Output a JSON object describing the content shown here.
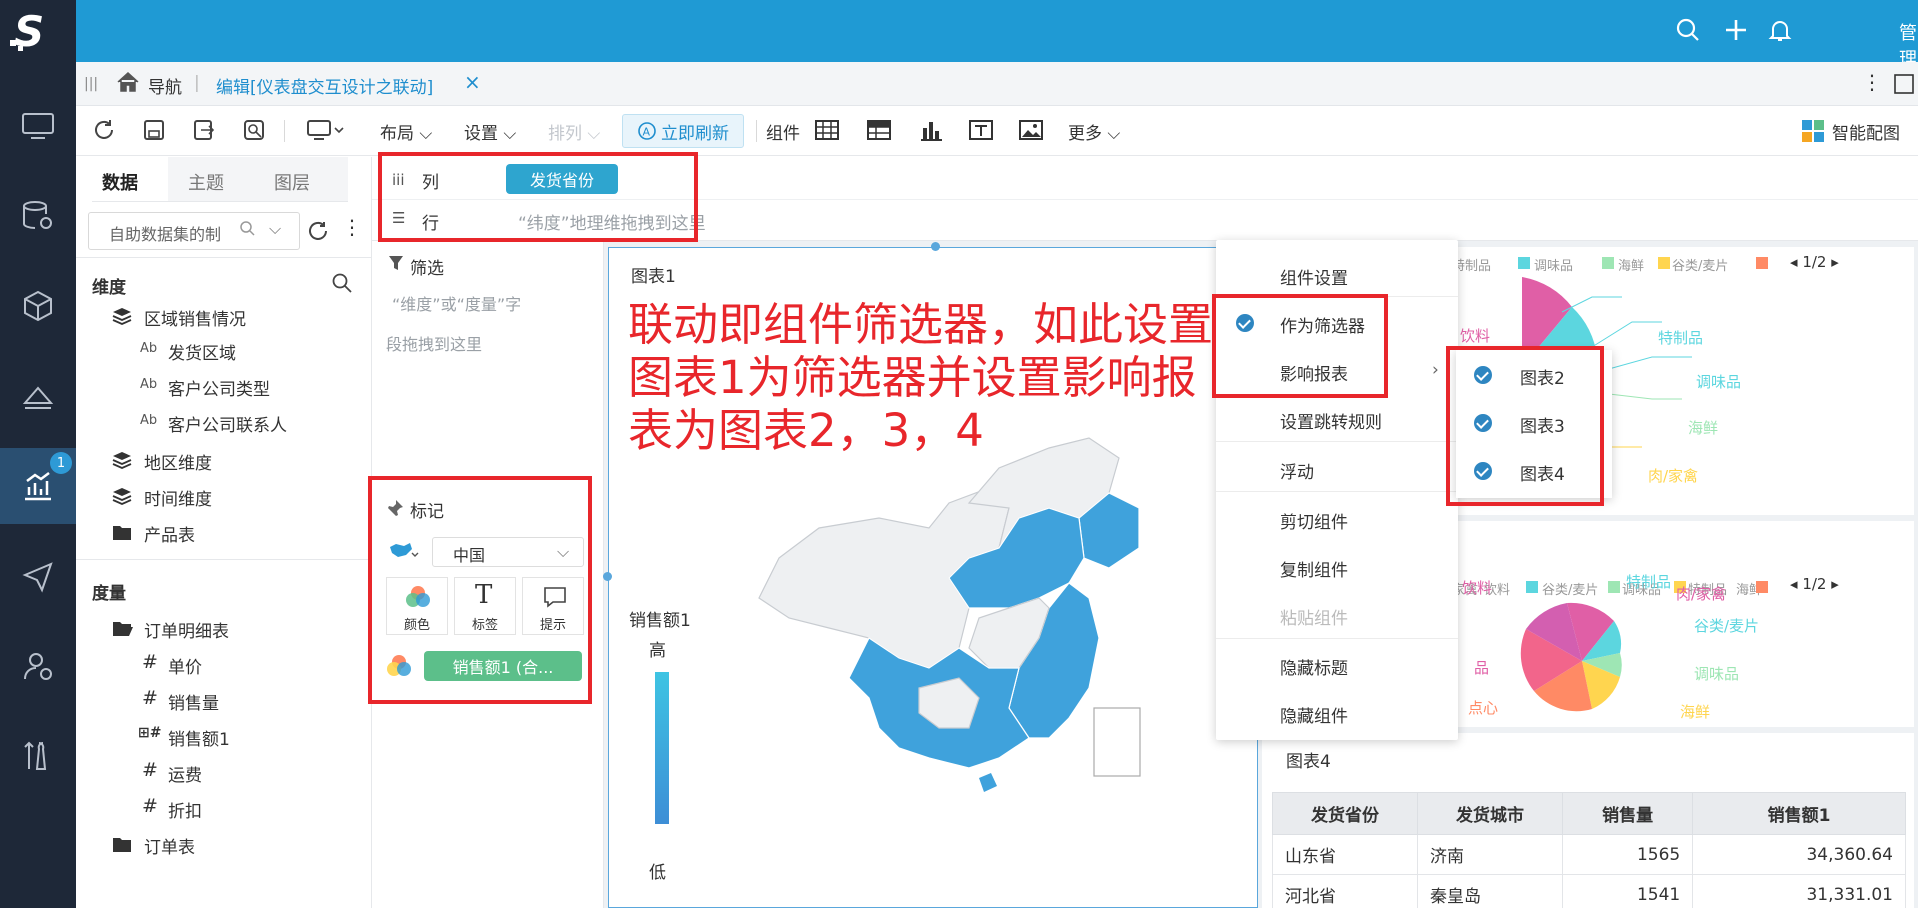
{
  "topbar": {
    "user_label": "管理员"
  },
  "sidebar": {
    "badge": "1"
  },
  "tabbar": {
    "nav_label": "导航",
    "tab_label": "编辑[仪表盘交互设计之联动]",
    "close": "×"
  },
  "toolbar": {
    "layout": "布局",
    "settings": "设置",
    "arrange": "排列",
    "refresh": "立即刷新",
    "component": "组件",
    "more": "更多",
    "smart": "智能配图"
  },
  "left_tabs": [
    "数据",
    "主题",
    "图层"
  ],
  "dataset_placeholder": "自助数据集的制",
  "dimension": {
    "title": "维度",
    "items": [
      "区域销售情况",
      "发货区域",
      "客户公司类型",
      "客户公司联系人",
      "地区维度",
      "时间维度",
      "产品表"
    ]
  },
  "measure": {
    "title": "度量",
    "items": [
      "订单明细表",
      "单价",
      "销售量",
      "销售额1",
      "运费",
      "折扣",
      "订单表"
    ]
  },
  "axis": {
    "col_label": "列",
    "col_field": "发货省份",
    "row_label": "行",
    "row_hint": "“纬度”地理维拖拽到这里"
  },
  "filter": {
    "title": "筛选",
    "hint1": "“维度”或“度量”字",
    "hint2": "段拖拽到这里"
  },
  "marks": {
    "title": "标记",
    "map_select": "中国",
    "color": "颜色",
    "label": "标签",
    "tooltip": "提示",
    "measure_pill": "销售额1 (合..."
  },
  "chart1": {
    "title": "图表1",
    "legend_title": "销售额1",
    "legend_high": "高",
    "legend_low": "低"
  },
  "annotation": "联动即组件筛选器，如此设置图表1为筛选器并设置影响报表为图表2，3，4",
  "context_menu": {
    "items": [
      "组件设置",
      "作为筛选器",
      "影响报表",
      "设置跳转规则",
      "浮动",
      "剪切组件",
      "复制组件",
      "粘贴组件",
      "隐藏标题",
      "隐藏组件"
    ]
  },
  "submenu": {
    "items": [
      "图表2",
      "图表3",
      "图表4"
    ]
  },
  "chart2": {
    "legend": [
      "特制品",
      "调味品",
      "海鲜",
      "谷类/麦片"
    ],
    "page": "1/2",
    "labels": [
      "饮料",
      "特制品",
      "调味品",
      "海鲜",
      "肉/家禽"
    ],
    "colors": [
      "#5cd6df",
      "#9ee6b4",
      "#ffd54f",
      "#ff8a65",
      "#e05fa6"
    ]
  },
  "chart3": {
    "legend": [
      "家禽",
      "饮料",
      "谷类/麦片",
      "调味品",
      "特制品",
      "海鲜"
    ],
    "page": "1/2",
    "labels": [
      "饮料",
      "特制品",
      "肉/家禽",
      "谷类/麦片",
      "调味品",
      "海鲜",
      "点心",
      "品"
    ]
  },
  "chart4": {
    "title": "图表4",
    "columns": [
      "发货省份",
      "发货城市",
      "销售量",
      "销售额1"
    ],
    "rows": [
      [
        "山东省",
        "济南",
        "1565",
        "34,360.64"
      ],
      [
        "河北省",
        "秦皇岛",
        "1541",
        "31,331.01"
      ]
    ]
  }
}
